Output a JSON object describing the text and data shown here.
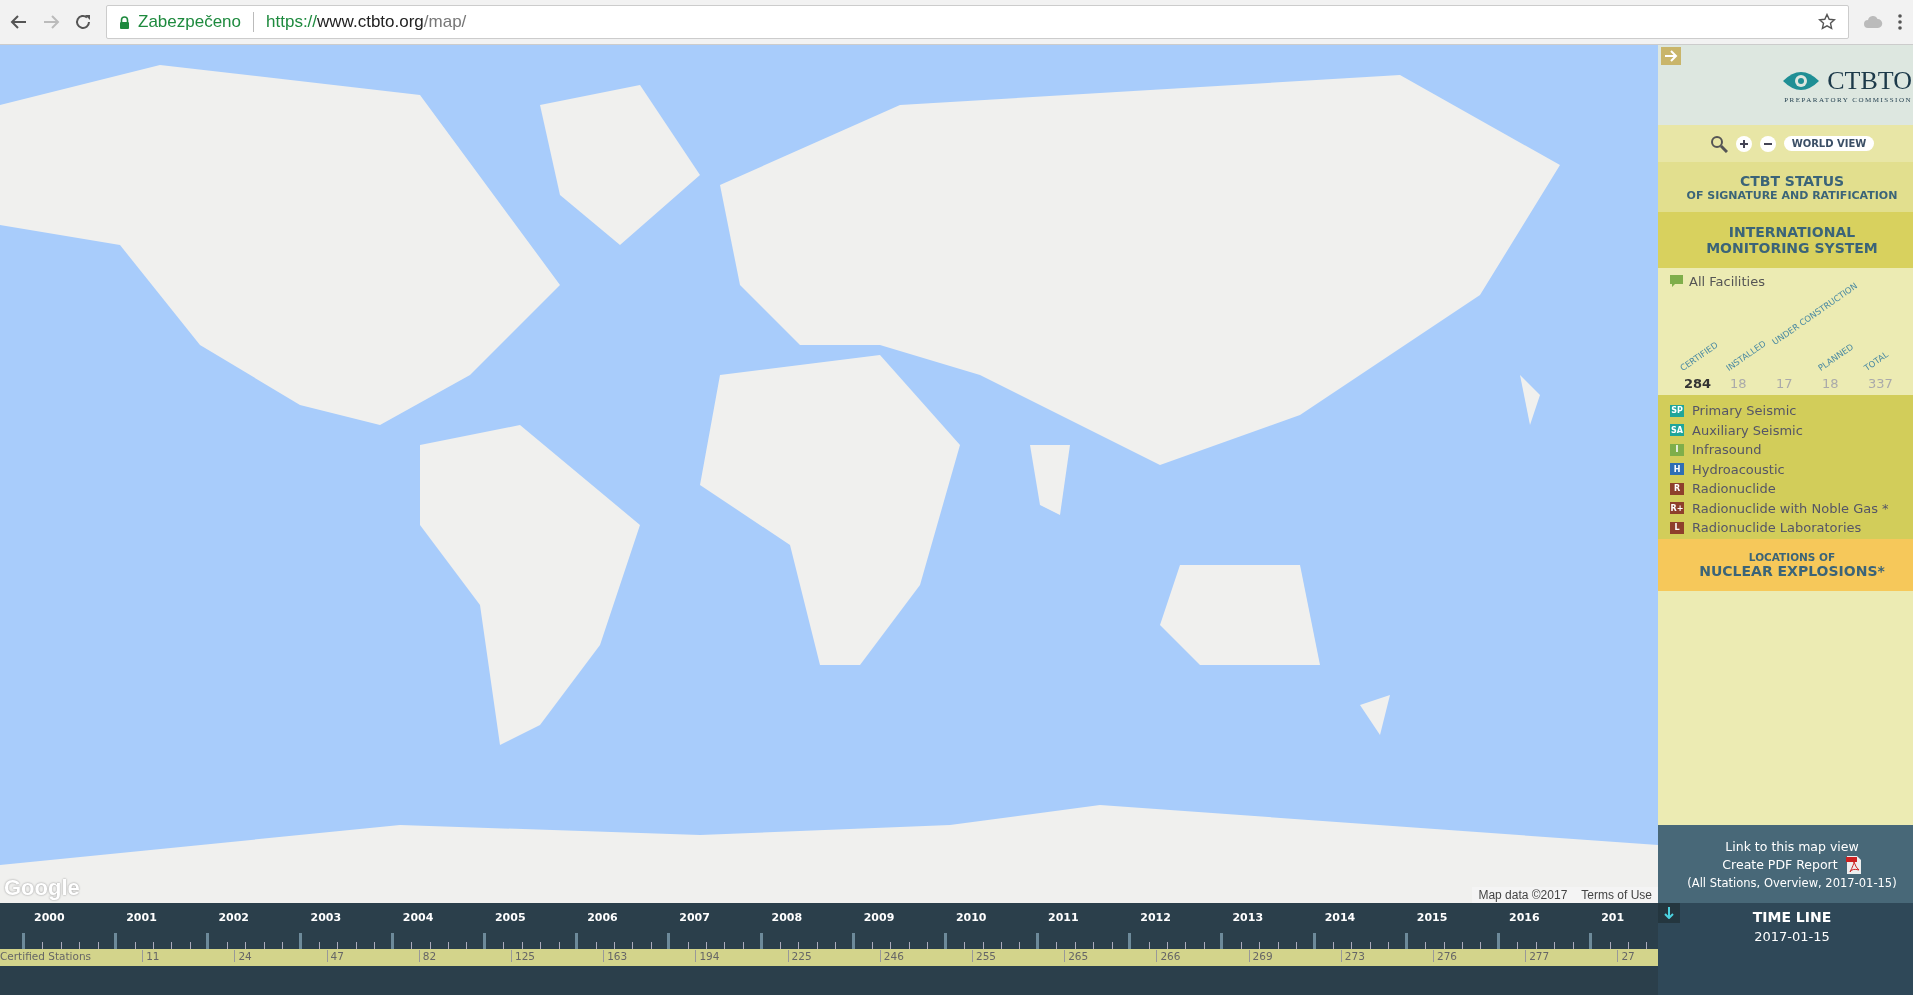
{
  "browser": {
    "security_label": "Zabezpečeno",
    "url_scheme": "https://",
    "url_host": "www.ctbto.org",
    "url_path": "/map/"
  },
  "map": {
    "kind": "picture",
    "logo": "Google",
    "attribution": "Map data ©2017",
    "terms": "Terms of Use"
  },
  "sidebar": {
    "logo_title": "CTBTO",
    "logo_subtitle": "PREPARATORY COMMISSION",
    "world_view": "WORLD VIEW",
    "status_title": "CTBT STATUS",
    "status_subtitle": "OF SIGNATURE AND RATIFICATION",
    "ims_title": "INTERNATIONAL MONITORING SYSTEM",
    "all_facilities": "All Facilities",
    "stats": [
      {
        "label": "CERTIFIED",
        "value": "284",
        "selected": true
      },
      {
        "label": "INSTALLED",
        "value": "18",
        "selected": false
      },
      {
        "label": "UNDER CONSTRUCTION",
        "value": "17",
        "selected": false
      },
      {
        "label": "PLANNED",
        "value": "18",
        "selected": false
      },
      {
        "label": "TOTAL",
        "value": "337",
        "selected": false
      }
    ],
    "legend": [
      {
        "badge": "SP",
        "label": "Primary Seismic",
        "color": "#1fa59a"
      },
      {
        "badge": "SA",
        "label": "Auxiliary Seismic",
        "color": "#1fa59a"
      },
      {
        "badge": "I",
        "label": "Infrasound",
        "color": "#7fae4a"
      },
      {
        "badge": "H",
        "label": "Hydroacoustic",
        "color": "#2f6fb5"
      },
      {
        "badge": "R",
        "label": "Radionuclide",
        "color": "#8e3f2c"
      },
      {
        "badge": "R+",
        "label": "Radionuclide with Noble Gas",
        "color": "#8e3f2c",
        "note": "*"
      },
      {
        "badge": "L",
        "label": "Radionuclide Laboratories",
        "color": "#8e3f2c"
      }
    ],
    "explosions_title": "LOCATIONS OF",
    "explosions_subtitle": "NUCLEAR EXPLOSIONS*",
    "link": "Link to this map view",
    "pdf": "Create PDF Report",
    "pdf_details": "(All Stations, Overview, 2017-01-15)",
    "timeline_title": "TIME LINE",
    "timeline_date": "2017-01-15"
  },
  "timeline": {
    "label": "Certified Stations",
    "years": [
      {
        "year": "2000"
      },
      {
        "year": "2001",
        "count": "11"
      },
      {
        "year": "2002",
        "count": "24"
      },
      {
        "year": "2003",
        "count": "47"
      },
      {
        "year": "2004",
        "count": "82"
      },
      {
        "year": "2005",
        "count": "125"
      },
      {
        "year": "2006",
        "count": "163"
      },
      {
        "year": "2007",
        "count": "194"
      },
      {
        "year": "2008",
        "count": "225"
      },
      {
        "year": "2009",
        "count": "246"
      },
      {
        "year": "2010",
        "count": "255"
      },
      {
        "year": "2011",
        "count": "265"
      },
      {
        "year": "2012",
        "count": "266"
      },
      {
        "year": "2013",
        "count": "269"
      },
      {
        "year": "2014",
        "count": "273"
      },
      {
        "year": "2015",
        "count": "276"
      },
      {
        "year": "2016",
        "count": "277"
      },
      {
        "year": "201",
        "count": "27"
      }
    ]
  }
}
